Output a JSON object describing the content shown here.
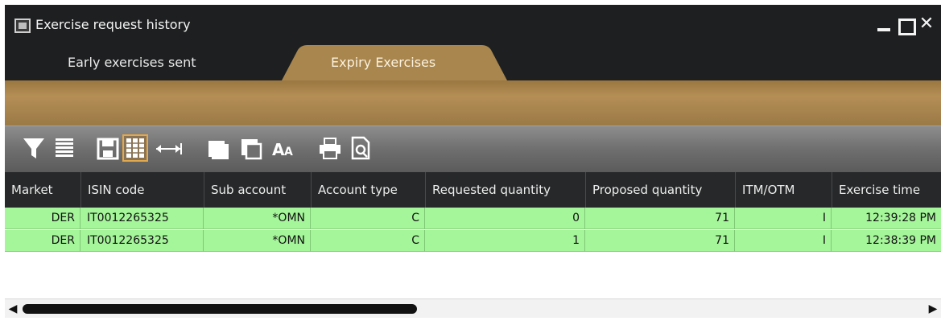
{
  "window": {
    "title": "Exercise request history",
    "icon": "app-window-icon",
    "controls": [
      "minimize-icon",
      "maximize-icon",
      "close-icon"
    ]
  },
  "tabs": [
    {
      "label": "Early exercises sent",
      "active": false
    },
    {
      "label": "Expiry Exercises",
      "active": true
    }
  ],
  "toolbar": {
    "icons": [
      "filter-icon",
      "list-icon",
      "save-icon",
      "columns-icon",
      "autosize-columns-icon",
      "copy-icon",
      "copy-all-icon",
      "font-size-icon",
      "print-icon",
      "print-preview-icon"
    ],
    "active_icon": "columns-icon"
  },
  "table": {
    "columns": [
      "Market",
      "ISIN code",
      "Sub account",
      "Account type",
      "Requested quantity",
      "Proposed quantity",
      "ITM/OTM",
      "Exercise time"
    ],
    "rows": [
      [
        "DER",
        "IT0012265325",
        "*OMN",
        "C",
        "0",
        "71",
        "I",
        "12:39:28 PM"
      ],
      [
        "DER",
        "IT0012265325",
        "*OMN",
        "C",
        "1",
        "71",
        "I",
        "12:38:39 PM"
      ]
    ],
    "row_color": "#a5f59a"
  },
  "colors": {
    "titlebar": "#1d1f21",
    "tab_active": "#a8864e",
    "band": "#b48e55",
    "header": "#262829"
  }
}
